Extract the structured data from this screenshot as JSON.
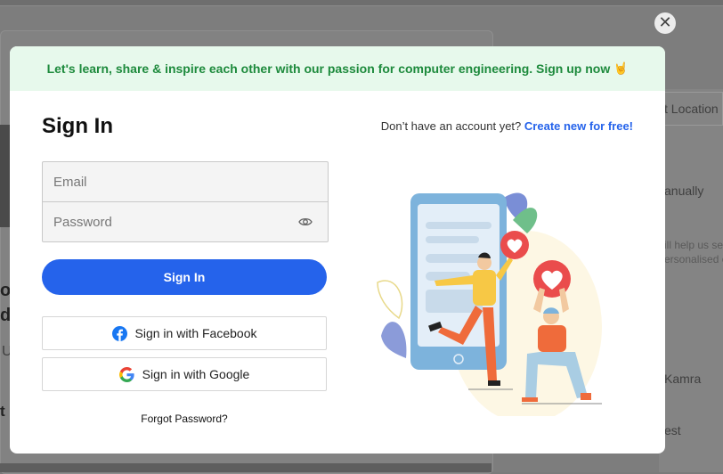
{
  "background": {
    "right_labels": [
      "t Location",
      "anually",
      "ill help us se",
      "ersonalised c",
      "Kamra",
      "est"
    ],
    "left_fragments": [
      "o",
      "d",
      "U",
      "t I"
    ]
  },
  "close": {
    "label": "✕"
  },
  "banner": {
    "text": "Let's learn, share & inspire each other with our passion for computer engineering. Sign up now",
    "icon_name": "rock-hand-icon",
    "icon_glyph": "🤘"
  },
  "signin": {
    "title": "Sign In",
    "signup_prompt": "Don’t have an account yet?",
    "signup_link": "Create new for free!",
    "email_placeholder": "Email",
    "password_placeholder": "Password",
    "submit_label": "Sign In",
    "facebook_label": "Sign in with Facebook",
    "google_label": "Sign in with Google",
    "forgot_label": "Forgot Password?"
  },
  "colors": {
    "accent": "#2563eb",
    "banner_bg": "#e7f9ec",
    "banner_text": "#1d8a3c",
    "facebook": "#1877f2"
  }
}
